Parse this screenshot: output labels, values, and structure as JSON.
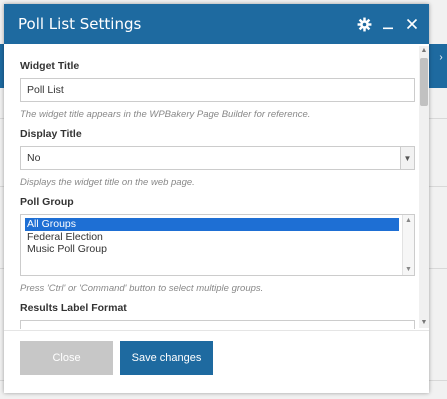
{
  "modal": {
    "title": "Poll List Settings",
    "header_icons": [
      "gear-icon",
      "minimize-icon",
      "close-icon"
    ]
  },
  "fields": {
    "widget_title": {
      "label": "Widget Title",
      "value": "Poll List",
      "hint": "The widget title appears in the WPBakery Page Builder for reference."
    },
    "display_title": {
      "label": "Display Title",
      "value": "No",
      "hint": "Displays the widget title on the web page."
    },
    "poll_group": {
      "label": "Poll Group",
      "options": [
        {
          "label": "All Groups",
          "selected": true
        },
        {
          "label": "Federal Election",
          "selected": false
        },
        {
          "label": "Music Poll Group",
          "selected": false
        }
      ],
      "hint": "Press 'Ctrl' or 'Command' button to select multiple groups."
    },
    "results_label_format": {
      "label": "Results Label Format"
    }
  },
  "footer": {
    "close_label": "Close",
    "save_label": "Save changes"
  },
  "colors": {
    "header_bg": "#1e6aa0",
    "save_bg": "#1e6aa0",
    "close_bg": "#c7c7c7",
    "selected_option_bg": "#1e6fd4"
  }
}
